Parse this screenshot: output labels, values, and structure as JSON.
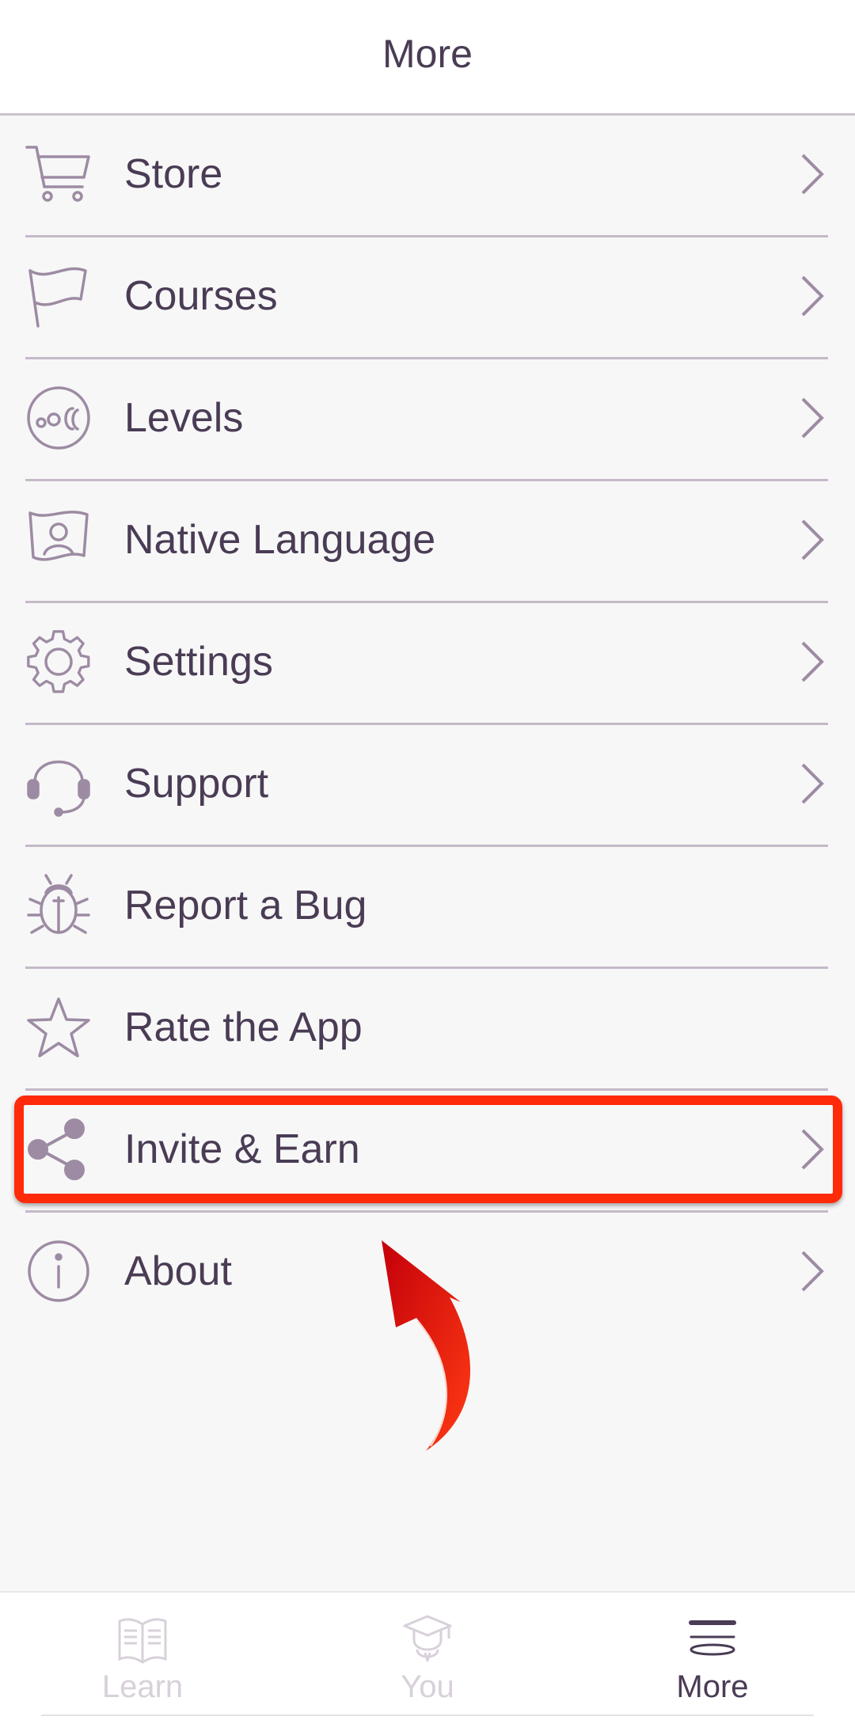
{
  "header": {
    "title": "More"
  },
  "menu": [
    {
      "label": "Store",
      "icon": "cart-icon",
      "chevron": true
    },
    {
      "label": "Courses",
      "icon": "flag-icon",
      "chevron": true
    },
    {
      "label": "Levels",
      "icon": "levels-icon",
      "chevron": true
    },
    {
      "label": "Native Language",
      "icon": "native-language-icon",
      "chevron": true
    },
    {
      "label": "Settings",
      "icon": "gear-icon",
      "chevron": true
    },
    {
      "label": "Support",
      "icon": "headset-icon",
      "chevron": true
    },
    {
      "label": "Report a Bug",
      "icon": "bug-icon",
      "chevron": false
    },
    {
      "label": "Rate the App",
      "icon": "star-icon",
      "chevron": false
    },
    {
      "label": "Invite & Earn",
      "icon": "share-icon",
      "chevron": true
    },
    {
      "label": "About",
      "icon": "info-icon",
      "chevron": true
    }
  ],
  "bottom_nav": {
    "tabs": [
      {
        "label": "Learn",
        "icon": "book-icon",
        "active": false
      },
      {
        "label": "You",
        "icon": "graduate-icon",
        "active": false
      },
      {
        "label": "More",
        "icon": "more-icon",
        "active": true
      }
    ]
  },
  "colors": {
    "text": "#4a3c55",
    "icon": "#9d8ba3",
    "divider": "#c5b9c8",
    "highlight": "#ff2a0a",
    "inactive_tab": "#d8d0da"
  }
}
